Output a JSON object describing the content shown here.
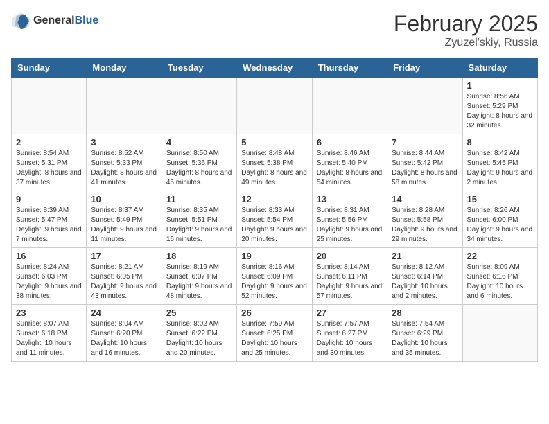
{
  "header": {
    "logo": {
      "general": "General",
      "blue": "Blue"
    },
    "title": "February 2025",
    "subtitle": "Zyuzel'skiy, Russia"
  },
  "weekdays": [
    "Sunday",
    "Monday",
    "Tuesday",
    "Wednesday",
    "Thursday",
    "Friday",
    "Saturday"
  ],
  "weeks": [
    [
      {
        "day": "",
        "info": ""
      },
      {
        "day": "",
        "info": ""
      },
      {
        "day": "",
        "info": ""
      },
      {
        "day": "",
        "info": ""
      },
      {
        "day": "",
        "info": ""
      },
      {
        "day": "",
        "info": ""
      },
      {
        "day": "1",
        "info": "Sunrise: 8:56 AM\nSunset: 5:29 PM\nDaylight: 8 hours and 32 minutes."
      }
    ],
    [
      {
        "day": "2",
        "info": "Sunrise: 8:54 AM\nSunset: 5:31 PM\nDaylight: 8 hours and 37 minutes."
      },
      {
        "day": "3",
        "info": "Sunrise: 8:52 AM\nSunset: 5:33 PM\nDaylight: 8 hours and 41 minutes."
      },
      {
        "day": "4",
        "info": "Sunrise: 8:50 AM\nSunset: 5:36 PM\nDaylight: 8 hours and 45 minutes."
      },
      {
        "day": "5",
        "info": "Sunrise: 8:48 AM\nSunset: 5:38 PM\nDaylight: 8 hours and 49 minutes."
      },
      {
        "day": "6",
        "info": "Sunrise: 8:46 AM\nSunset: 5:40 PM\nDaylight: 8 hours and 54 minutes."
      },
      {
        "day": "7",
        "info": "Sunrise: 8:44 AM\nSunset: 5:42 PM\nDaylight: 8 hours and 58 minutes."
      },
      {
        "day": "8",
        "info": "Sunrise: 8:42 AM\nSunset: 5:45 PM\nDaylight: 9 hours and 2 minutes."
      }
    ],
    [
      {
        "day": "9",
        "info": "Sunrise: 8:39 AM\nSunset: 5:47 PM\nDaylight: 9 hours and 7 minutes."
      },
      {
        "day": "10",
        "info": "Sunrise: 8:37 AM\nSunset: 5:49 PM\nDaylight: 9 hours and 11 minutes."
      },
      {
        "day": "11",
        "info": "Sunrise: 8:35 AM\nSunset: 5:51 PM\nDaylight: 9 hours and 16 minutes."
      },
      {
        "day": "12",
        "info": "Sunrise: 8:33 AM\nSunset: 5:54 PM\nDaylight: 9 hours and 20 minutes."
      },
      {
        "day": "13",
        "info": "Sunrise: 8:31 AM\nSunset: 5:56 PM\nDaylight: 9 hours and 25 minutes."
      },
      {
        "day": "14",
        "info": "Sunrise: 8:28 AM\nSunset: 5:58 PM\nDaylight: 9 hours and 29 minutes."
      },
      {
        "day": "15",
        "info": "Sunrise: 8:26 AM\nSunset: 6:00 PM\nDaylight: 9 hours and 34 minutes."
      }
    ],
    [
      {
        "day": "16",
        "info": "Sunrise: 8:24 AM\nSunset: 6:03 PM\nDaylight: 9 hours and 38 minutes."
      },
      {
        "day": "17",
        "info": "Sunrise: 8:21 AM\nSunset: 6:05 PM\nDaylight: 9 hours and 43 minutes."
      },
      {
        "day": "18",
        "info": "Sunrise: 8:19 AM\nSunset: 6:07 PM\nDaylight: 9 hours and 48 minutes."
      },
      {
        "day": "19",
        "info": "Sunrise: 8:16 AM\nSunset: 6:09 PM\nDaylight: 9 hours and 52 minutes."
      },
      {
        "day": "20",
        "info": "Sunrise: 8:14 AM\nSunset: 6:11 PM\nDaylight: 9 hours and 57 minutes."
      },
      {
        "day": "21",
        "info": "Sunrise: 8:12 AM\nSunset: 6:14 PM\nDaylight: 10 hours and 2 minutes."
      },
      {
        "day": "22",
        "info": "Sunrise: 8:09 AM\nSunset: 6:16 PM\nDaylight: 10 hours and 6 minutes."
      }
    ],
    [
      {
        "day": "23",
        "info": "Sunrise: 8:07 AM\nSunset: 6:18 PM\nDaylight: 10 hours and 11 minutes."
      },
      {
        "day": "24",
        "info": "Sunrise: 8:04 AM\nSunset: 6:20 PM\nDaylight: 10 hours and 16 minutes."
      },
      {
        "day": "25",
        "info": "Sunrise: 8:02 AM\nSunset: 6:22 PM\nDaylight: 10 hours and 20 minutes."
      },
      {
        "day": "26",
        "info": "Sunrise: 7:59 AM\nSunset: 6:25 PM\nDaylight: 10 hours and 25 minutes."
      },
      {
        "day": "27",
        "info": "Sunrise: 7:57 AM\nSunset: 6:27 PM\nDaylight: 10 hours and 30 minutes."
      },
      {
        "day": "28",
        "info": "Sunrise: 7:54 AM\nSunset: 6:29 PM\nDaylight: 10 hours and 35 minutes."
      },
      {
        "day": "",
        "info": ""
      }
    ]
  ]
}
